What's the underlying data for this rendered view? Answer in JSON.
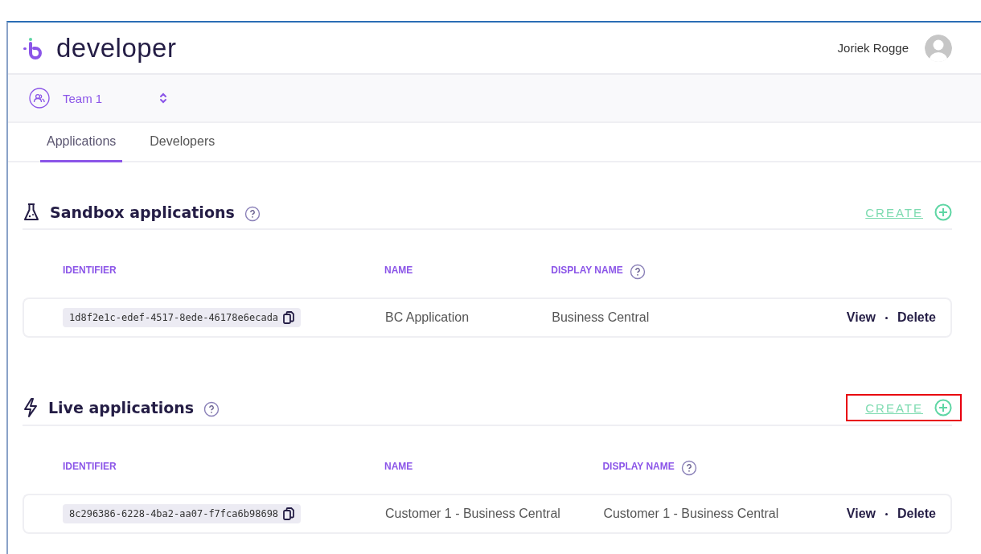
{
  "header": {
    "logo_text": "developer",
    "user_name": "Joriek Rogge"
  },
  "team": {
    "name": "Team 1"
  },
  "tabs": [
    {
      "label": "Applications",
      "selected": true
    },
    {
      "label": "Developers",
      "selected": false
    }
  ],
  "sections": [
    {
      "kind": "sandbox",
      "title": "Sandbox applications",
      "create_label": "CREATE",
      "highlighted": false,
      "columns": [
        "IDENTIFIER",
        "NAME",
        "DISPLAY NAME"
      ],
      "rows": [
        {
          "identifier": "1d8f2e1c-edef-4517-8ede-46178e6ecada",
          "name": "BC Application",
          "display_name": "Business Central",
          "actions": [
            "View",
            "Delete"
          ]
        }
      ]
    },
    {
      "kind": "live",
      "title": "Live applications",
      "create_label": "CREATE",
      "highlighted": true,
      "columns": [
        "IDENTIFIER",
        "NAME",
        "DISPLAY NAME"
      ],
      "rows": [
        {
          "identifier": "8c296386-6228-4ba2-aa07-f7fca6b98698",
          "name": "Customer 1 - Business Central",
          "display_name": "Customer 1 - Business Central",
          "actions": [
            "View",
            "Delete"
          ]
        }
      ]
    }
  ]
}
